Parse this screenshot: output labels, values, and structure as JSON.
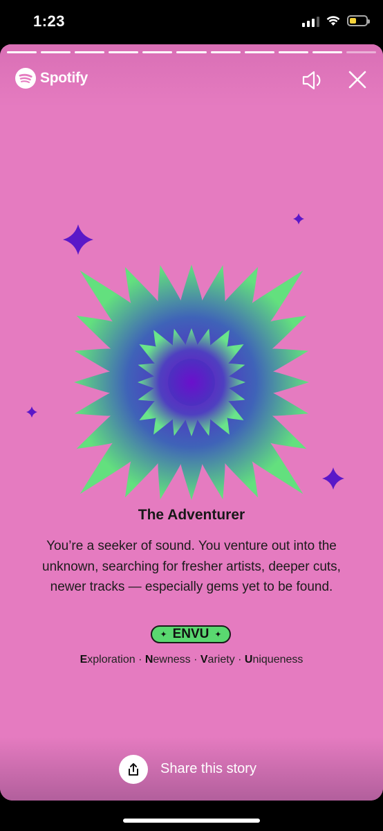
{
  "status_bar": {
    "time": "1:23"
  },
  "story": {
    "progress_segments_total": 11,
    "progress_segments_done": 10,
    "brand_name": "Spotify",
    "title": "The Adventurer",
    "description": "You’re a seeker of sound. You venture out into the unknown, searching for fresher artists, deeper cuts, newer tracks — especially gems yet to be found.",
    "badge": {
      "spark": "✦",
      "code": "ENVU"
    },
    "traits": [
      {
        "initial": "E",
        "rest": "xploration"
      },
      {
        "initial": "N",
        "rest": "ewness"
      },
      {
        "initial": "V",
        "rest": "ariety"
      },
      {
        "initial": "U",
        "rest": "niqueness"
      }
    ],
    "separator": " · ",
    "share_label": "Share this story"
  },
  "colors": {
    "background": "#e57bc0",
    "accent_green": "#5ad870",
    "accent_purple": "#5a18c8"
  },
  "icons": [
    "spotify-logo-icon",
    "volume-icon",
    "close-icon",
    "share-icon",
    "sparkle-icon"
  ]
}
